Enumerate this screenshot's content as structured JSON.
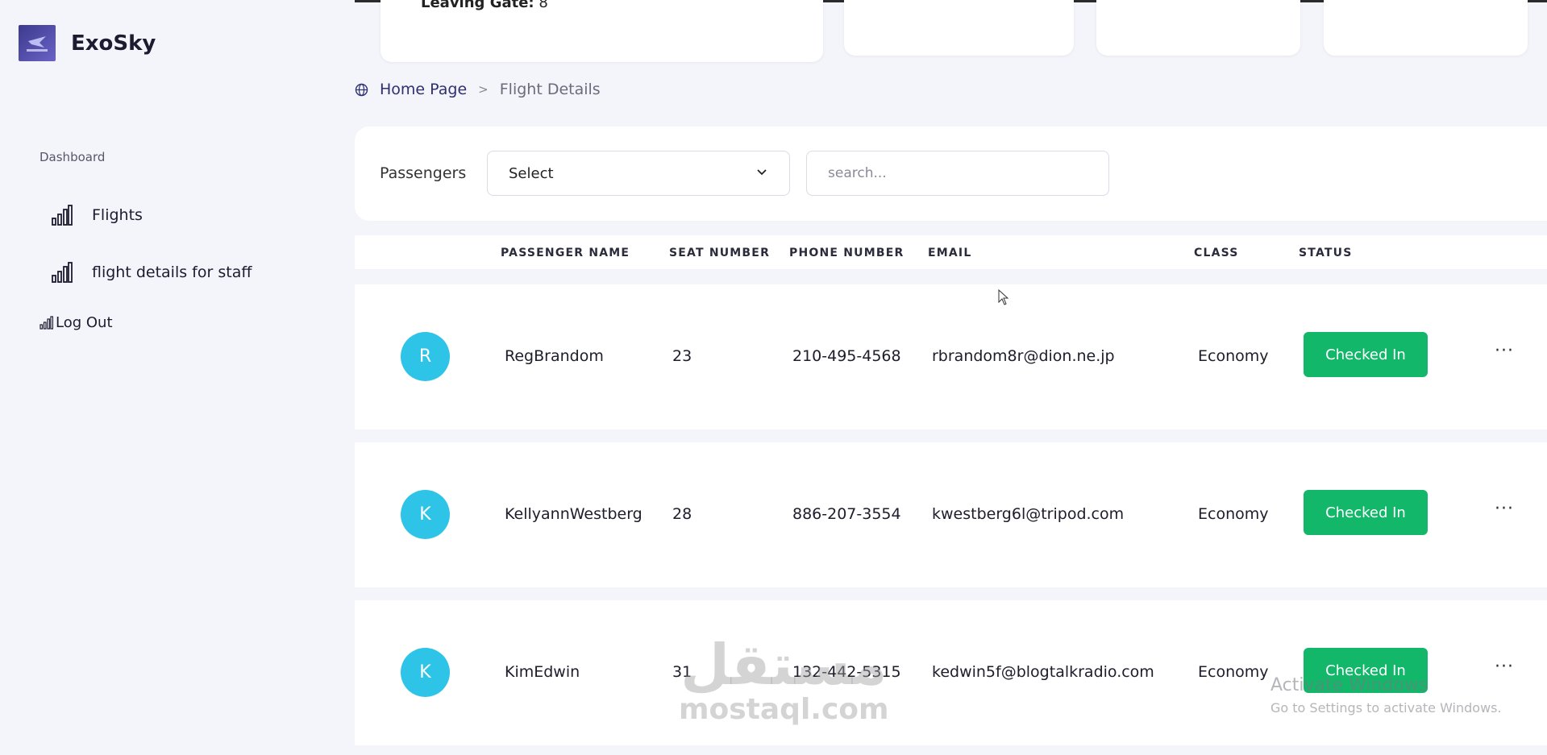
{
  "app": {
    "brand": "ExoSky"
  },
  "top": {
    "gate_label": "Leaving Gate:",
    "gate_value": " 8"
  },
  "sidebar": {
    "section": "Dashboard",
    "items": [
      {
        "label": "Flights",
        "icon": "bar-chart-icon"
      },
      {
        "label": "flight details for staff",
        "icon": "bar-chart-icon"
      }
    ],
    "logout": "Log Out"
  },
  "breadcrumb": {
    "home": "Home Page",
    "separator": ">",
    "current": "Flight Details"
  },
  "filter": {
    "label": "Passengers",
    "select_value": "Select",
    "search_placeholder": "search..."
  },
  "table": {
    "columns": [
      "PASSENGER NAME",
      "SEAT NUMBER",
      "PHONE NUMBER",
      "EMAIL",
      "CLASS",
      "STATUS"
    ],
    "rows": [
      {
        "initial": "R",
        "name": "RegBrandom",
        "seat": "23",
        "phone": "210-495-4568",
        "email": "rbrandom8r@dion.ne.jp",
        "class": "Economy",
        "status": "Checked In",
        "more": "···"
      },
      {
        "initial": "K",
        "name": "KellyannWestberg",
        "seat": "28",
        "phone": "886-207-3554",
        "email": "kwestberg6l@tripod.com",
        "class": "Economy",
        "status": "Checked In",
        "more": "···"
      },
      {
        "initial": "K",
        "name": "KimEdwin",
        "seat": "31",
        "phone": "132-442-5315",
        "email": "kedwin5f@blogtalkradio.com",
        "class": "Economy",
        "status": "Checked In",
        "more": "···"
      }
    ]
  },
  "overlay": {
    "watermark_ar": "مستقل",
    "watermark_lat": "mostaql.com",
    "activate_title": "Activate Windows",
    "activate_sub": "Go to Settings to activate Windows."
  },
  "colors": {
    "accent": "#2f2e73",
    "status_green": "#12b76a",
    "avatar": "#2ec4e8"
  }
}
